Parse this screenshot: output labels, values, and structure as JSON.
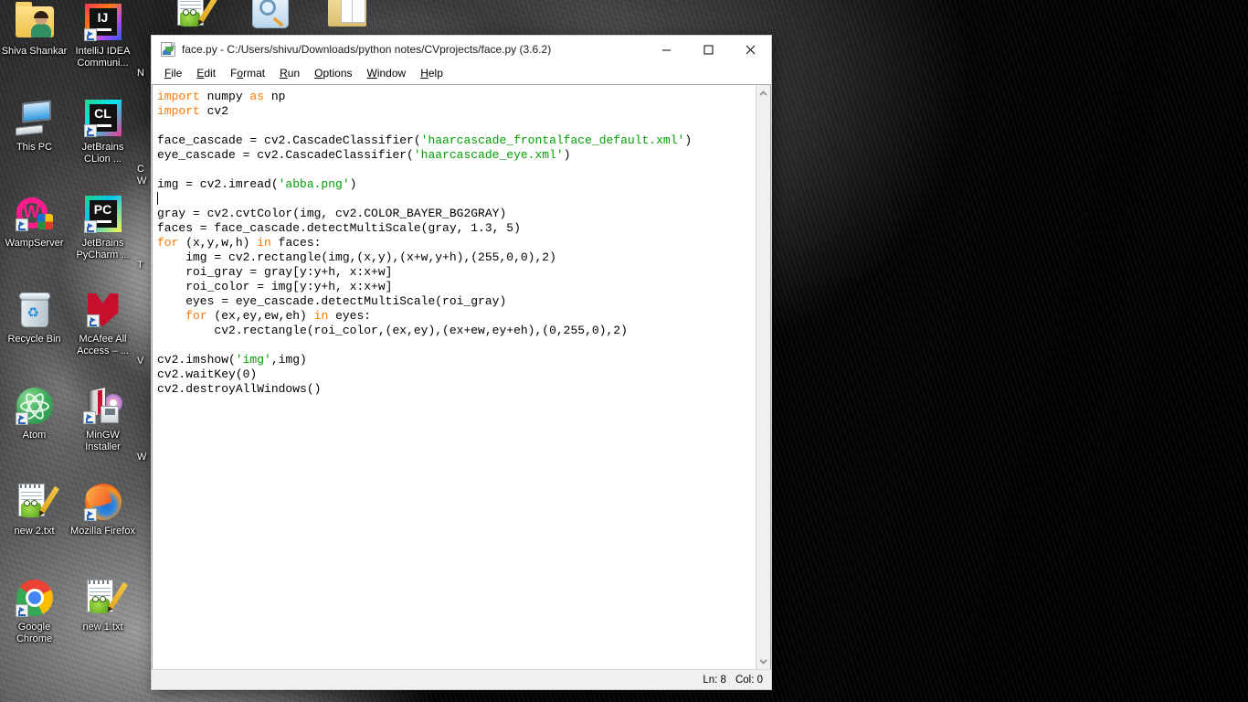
{
  "desktop": {
    "icons": [
      {
        "label": "Shiva Shankar",
        "icon": "user-folder-icon"
      },
      {
        "label": "IntelliJ IDEA Communi...",
        "icon": "intellij-idea-icon"
      },
      {
        "label": "This PC",
        "icon": "this-pc-icon"
      },
      {
        "label": "JetBrains CLion ...",
        "icon": "clion-icon"
      },
      {
        "label": "WampServer",
        "icon": "wampserver-icon"
      },
      {
        "label": "JetBrains PyCharm ...",
        "icon": "pycharm-icon"
      },
      {
        "label": "Recycle Bin",
        "icon": "recycle-bin-icon"
      },
      {
        "label": "McAfee All Access – ...",
        "icon": "mcafee-icon"
      },
      {
        "label": "Atom",
        "icon": "atom-icon"
      },
      {
        "label": "MinGW Installer",
        "icon": "mingw-installer-icon"
      },
      {
        "label": "new 2.txt",
        "icon": "text-file-icon"
      },
      {
        "label": "Mozilla Firefox",
        "icon": "firefox-icon"
      },
      {
        "label": "Google Chrome",
        "icon": "chrome-icon"
      },
      {
        "label": "new 1.txt",
        "icon": "text-file-icon"
      }
    ],
    "top_cut_icons": [
      {
        "label": "",
        "icon": "text-file-icon"
      },
      {
        "label": "",
        "icon": "search-icon"
      },
      {
        "label": "",
        "icon": "folder-icon"
      }
    ],
    "occluded_column_initials": [
      "N",
      "C",
      "W",
      "T",
      "V",
      "W"
    ]
  },
  "window": {
    "title": "face.py - C:/Users/shivu/Downloads/python notes/CVprojects/face.py (3.6.2)",
    "icon": "python-file-icon",
    "buttons": {
      "minimize": "minimize-button",
      "maximize": "maximize-button",
      "close": "close-button"
    },
    "menu": [
      {
        "label": "File",
        "mnemonic": "F"
      },
      {
        "label": "Edit",
        "mnemonic": "E"
      },
      {
        "label": "Format",
        "mnemonic": "o"
      },
      {
        "label": "Run",
        "mnemonic": "R"
      },
      {
        "label": "Options",
        "mnemonic": "O"
      },
      {
        "label": "Window",
        "mnemonic": "W"
      },
      {
        "label": "Help",
        "mnemonic": "H"
      }
    ],
    "statusbar": {
      "line": "Ln: 8",
      "column": "Col: 0"
    }
  },
  "editor": {
    "code_lines": [
      [
        {
          "t": "import",
          "c": "kw"
        },
        {
          "t": " numpy ",
          "c": ""
        },
        {
          "t": "as",
          "c": "kw"
        },
        {
          "t": " np",
          "c": ""
        }
      ],
      [
        {
          "t": "import",
          "c": "kw"
        },
        {
          "t": " cv2",
          "c": ""
        }
      ],
      [],
      [
        {
          "t": "face_cascade = cv2.CascadeClassifier(",
          "c": ""
        },
        {
          "t": "'haarcascade_frontalface_default.xml'",
          "c": "str"
        },
        {
          "t": ")",
          "c": ""
        }
      ],
      [
        {
          "t": "eye_cascade = cv2.CascadeClassifier(",
          "c": ""
        },
        {
          "t": "'haarcascade_eye.xml'",
          "c": "str"
        },
        {
          "t": ")",
          "c": ""
        }
      ],
      [],
      [
        {
          "t": "img = cv2.imread(",
          "c": ""
        },
        {
          "t": "'abba.png'",
          "c": "str"
        },
        {
          "t": ")",
          "c": ""
        }
      ],
      [
        {
          "t": "",
          "c": "caret"
        }
      ],
      [
        {
          "t": "gray = cv2.cvtColor(img, cv2.COLOR_BAYER_BG2GRAY)",
          "c": ""
        }
      ],
      [
        {
          "t": "faces = face_cascade.detectMultiScale(gray, 1.3, 5)",
          "c": ""
        }
      ],
      [
        {
          "t": "for",
          "c": "kw"
        },
        {
          "t": " (x,y,w,h) ",
          "c": ""
        },
        {
          "t": "in",
          "c": "kw"
        },
        {
          "t": " faces:",
          "c": ""
        }
      ],
      [
        {
          "t": "    img = cv2.rectangle(img,(x,y),(x+w,y+h),(255,0,0),2)",
          "c": ""
        }
      ],
      [
        {
          "t": "    roi_gray = gray[y:y+h, x:x+w]",
          "c": ""
        }
      ],
      [
        {
          "t": "    roi_color = img[y:y+h, x:x+w]",
          "c": ""
        }
      ],
      [
        {
          "t": "    eyes = eye_cascade.detectMultiScale(roi_gray)",
          "c": ""
        }
      ],
      [
        {
          "t": "    ",
          "c": ""
        },
        {
          "t": "for",
          "c": "kw"
        },
        {
          "t": " (ex,ey,ew,eh) ",
          "c": ""
        },
        {
          "t": "in",
          "c": "kw"
        },
        {
          "t": " eyes:",
          "c": ""
        }
      ],
      [
        {
          "t": "        cv2.rectangle(roi_color,(ex,ey),(ex+ew,ey+eh),(0,255,0),2)",
          "c": ""
        }
      ],
      [],
      [
        {
          "t": "cv2.imshow(",
          "c": ""
        },
        {
          "t": "'img'",
          "c": "str"
        },
        {
          "t": ",img)",
          "c": ""
        }
      ],
      [
        {
          "t": "cv2.waitKey(0)",
          "c": ""
        }
      ],
      [
        {
          "t": "cv2.destroyAllWindows()",
          "c": ""
        }
      ]
    ],
    "scrollbar": {
      "up_arrow": "scroll-up-icon",
      "down_arrow": "scroll-down-icon"
    }
  },
  "colors": {
    "keyword": "#ff7700",
    "string": "#00a000",
    "text": "#000000",
    "window_bg": "#f0f0f0",
    "editor_bg": "#ffffff"
  }
}
